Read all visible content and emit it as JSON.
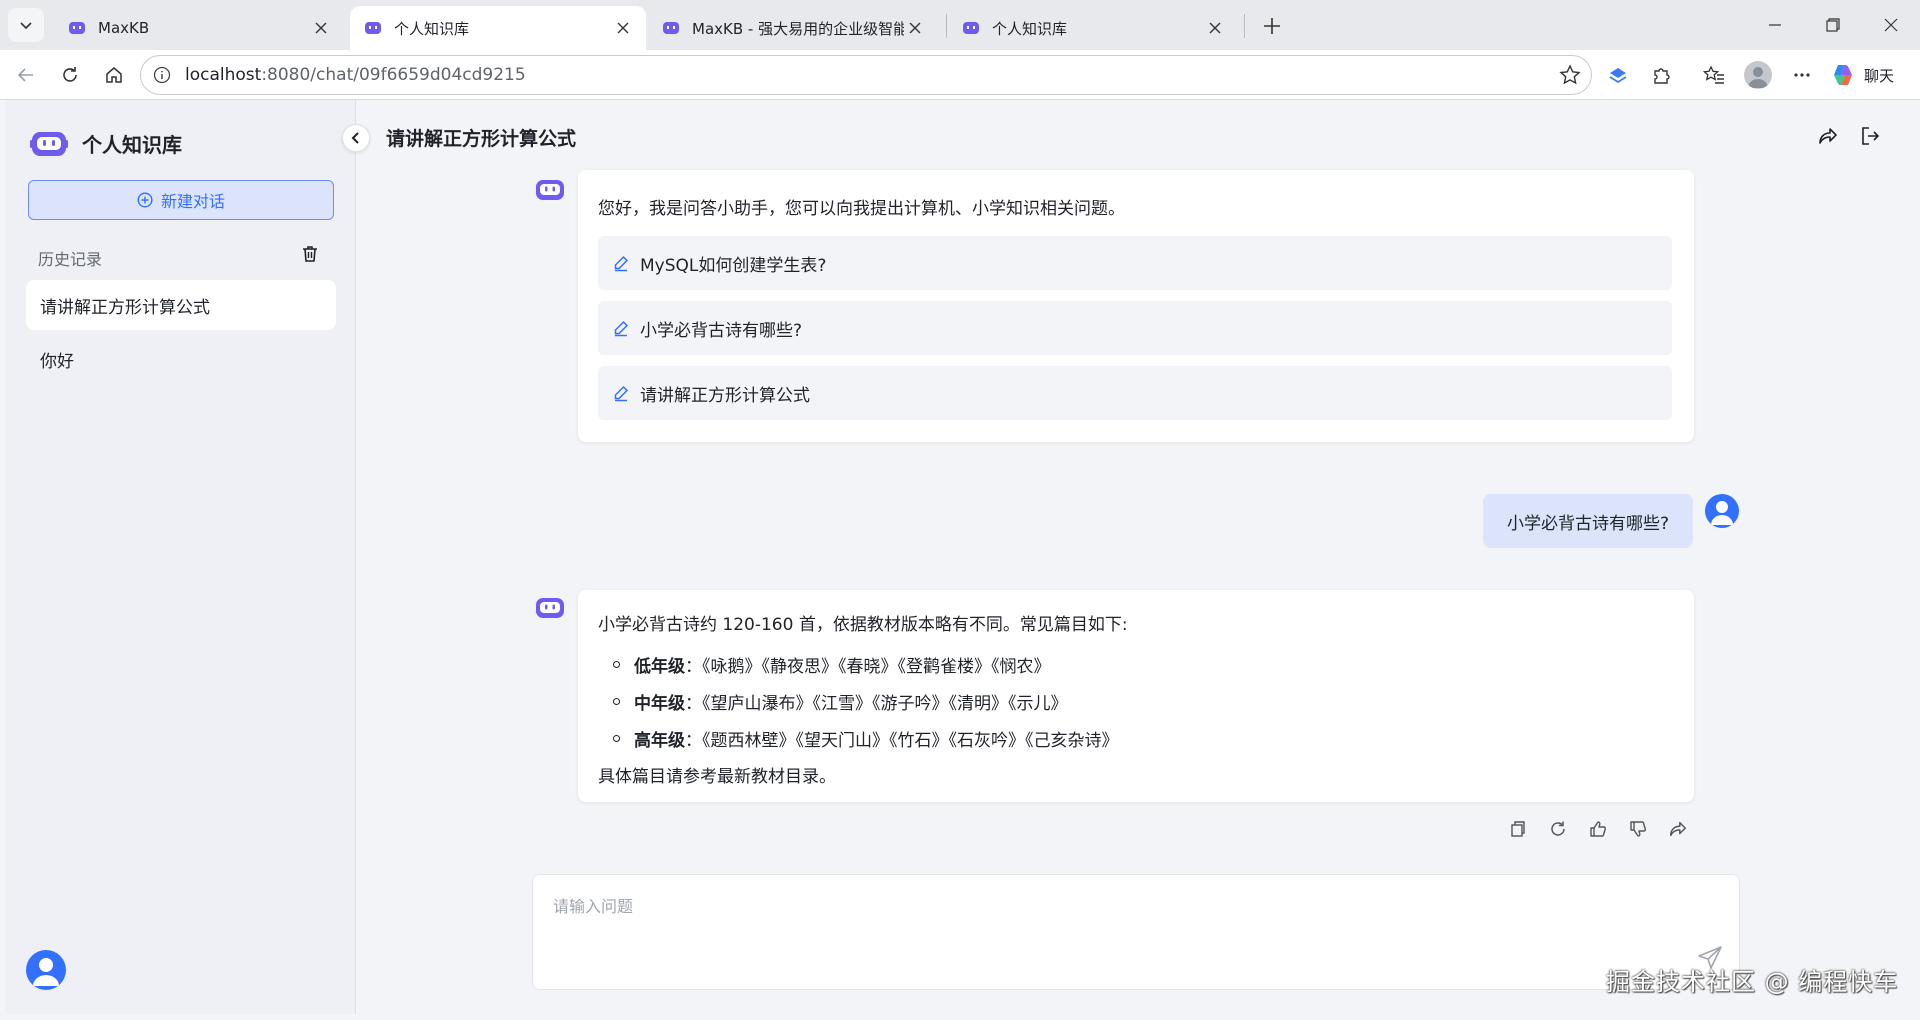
{
  "browser": {
    "tabs": [
      {
        "title": "MaxKB",
        "active": false
      },
      {
        "title": "个人知识库",
        "active": true
      },
      {
        "title": "MaxKB - 强大易用的企业级智能体",
        "active": false
      },
      {
        "title": "个人知识库",
        "active": false
      }
    ],
    "url_host": "localhost",
    "url_rest": ":8080/chat/09f6659d04cd9215",
    "chat_label": "聊天"
  },
  "sidebar": {
    "app_name": "个人知识库",
    "new_chat_label": "新建对话",
    "history_title": "历史记录",
    "history": [
      {
        "label": "请讲解正方形计算公式",
        "active": true
      },
      {
        "label": "你好",
        "active": false
      }
    ]
  },
  "chat": {
    "title": "请讲解正方形计算公式",
    "welcome": {
      "text": "您好，我是问答小助手，您可以向我提出计算机、小学知识相关问题。",
      "prompts": [
        "MySQL如何创建学生表?",
        "小学必背古诗有哪些?",
        "请讲解正方形计算公式"
      ]
    },
    "user_message": "小学必背古诗有哪些?",
    "answer": {
      "intro": "小学必背古诗约 120-160 首，依据教材版本略有不同。常见篇目如下:",
      "items": [
        {
          "grade": "低年级",
          "poems": "：《咏鹅》《静夜思》《春晓》《登鹳雀楼》《悯农》"
        },
        {
          "grade": "中年级",
          "poems": "：《望庐山瀑布》《江雪》《游子吟》《清明》《示儿》"
        },
        {
          "grade": "高年级",
          "poems": "：《题西林壁》《望天门山》《竹石》《石灰吟》《己亥杂诗》"
        }
      ],
      "outro": "具体篇目请参考最新教材目录。"
    },
    "input_placeholder": "请输入问题"
  },
  "watermark": "掘金技术社区 @ 编程快车",
  "colors": {
    "accent": "#3370ff",
    "bot": "#6e5cf0"
  }
}
